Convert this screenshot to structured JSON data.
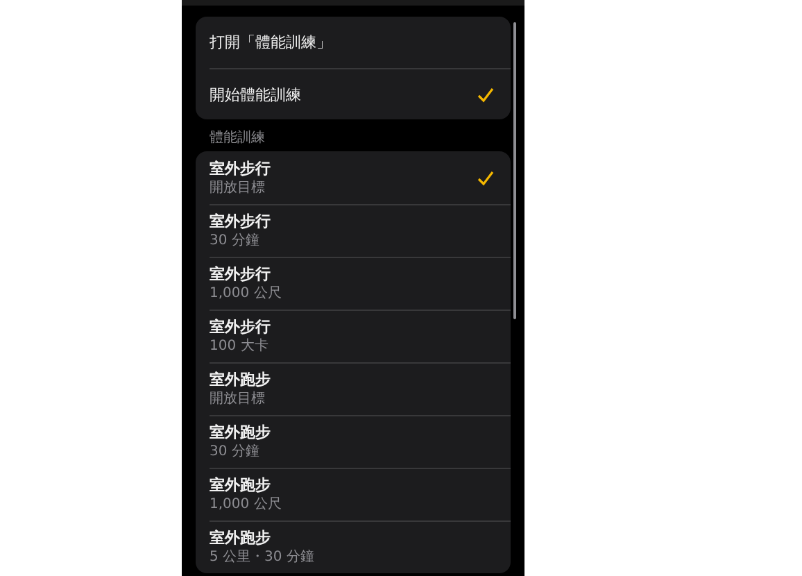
{
  "actions": [
    {
      "label": "打開「體能訓練」",
      "selected": false
    },
    {
      "label": "開始體能訓練",
      "selected": true
    }
  ],
  "section_title": "體能訓練",
  "workouts": [
    {
      "title": "室外步行",
      "detail": "開放目標",
      "selected": true
    },
    {
      "title": "室外步行",
      "detail": "30 分鐘",
      "selected": false
    },
    {
      "title": "室外步行",
      "detail": "1,000 公尺",
      "selected": false
    },
    {
      "title": "室外步行",
      "detail": "100 大卡",
      "selected": false
    },
    {
      "title": "室外跑步",
      "detail": "開放目標",
      "selected": false
    },
    {
      "title": "室外跑步",
      "detail": "30 分鐘",
      "selected": false
    },
    {
      "title": "室外跑步",
      "detail": "1,000 公尺",
      "selected": false
    },
    {
      "title": "室外跑步",
      "detail": "5 公里・30 分鐘",
      "selected": false
    }
  ]
}
